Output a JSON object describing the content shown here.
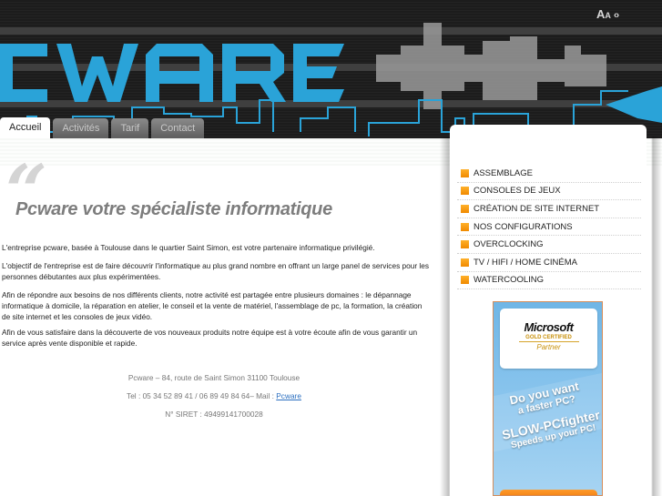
{
  "header": {
    "logo_text": "PCWARE",
    "font_tools": {
      "large_a": "A",
      "small_a": "A",
      "arrows": "‹›"
    },
    "brand_color": "#2aa3d8"
  },
  "tabs": [
    {
      "label": "Accueil",
      "active": true
    },
    {
      "label": "Activités",
      "active": false
    },
    {
      "label": "Tarif",
      "active": false
    },
    {
      "label": "Contact",
      "active": false
    }
  ],
  "main": {
    "quote_mark": "“",
    "title": "Pcware votre spécialiste informatique",
    "paragraphs": [
      "L'entreprise pcware, basée à Toulouse dans le quartier Saint Simon, est votre partenaire informatique privilégié.",
      "L'objectif de l'entreprise est de faire découvrir l'informatique au plus grand nombre en offrant un large panel de services pour les personnes débutantes aux plus expérimentées.",
      "Afin de répondre aux besoins de nos différents clients, notre activité est partagée entre plusieurs domaines : le dépannage informatique à domicile, la réparation en atelier, le conseil et la vente de matériel, l'assemblage de pc, la formation, la création de site internet et les consoles de jeux vidéo.",
      "Afin de vous satisfaire dans la découverte de vos nouveaux produits notre équipe est à votre écoute afin de vous garantir un service après vente disponible et rapide."
    ],
    "footer": {
      "address": "Pcware – 84, route de Saint Simon 31100 Toulouse",
      "phone_prefix": "Tel : 05 34 52 89 41 / 06 89 49 84 64– Mail : ",
      "mail_link": "Pcware",
      "siret": "N° SIRET : 49499141700028"
    }
  },
  "sidebar": {
    "items": [
      {
        "label": "ASSEMBLAGE"
      },
      {
        "label": "CONSOLES DE JEUX"
      },
      {
        "label": "CRÉATION DE SITE INTERNET"
      },
      {
        "label": "NOS CONFIGURATIONS"
      },
      {
        "label": "OVERCLOCKING"
      },
      {
        "label": "TV / HIFI / HOME CINÉMA"
      },
      {
        "label": "WATERCOOLING"
      }
    ],
    "bullet_color": "#f7a21b"
  },
  "ad": {
    "badge_brand": "Microsoft",
    "badge_line": "GOLD CERTIFIED",
    "badge_partner": "Partner",
    "line1": "Do you want",
    "line2": "a faster PC?",
    "line3": "SLOW-PCfighter",
    "line4": "Speeds up your PC!"
  }
}
